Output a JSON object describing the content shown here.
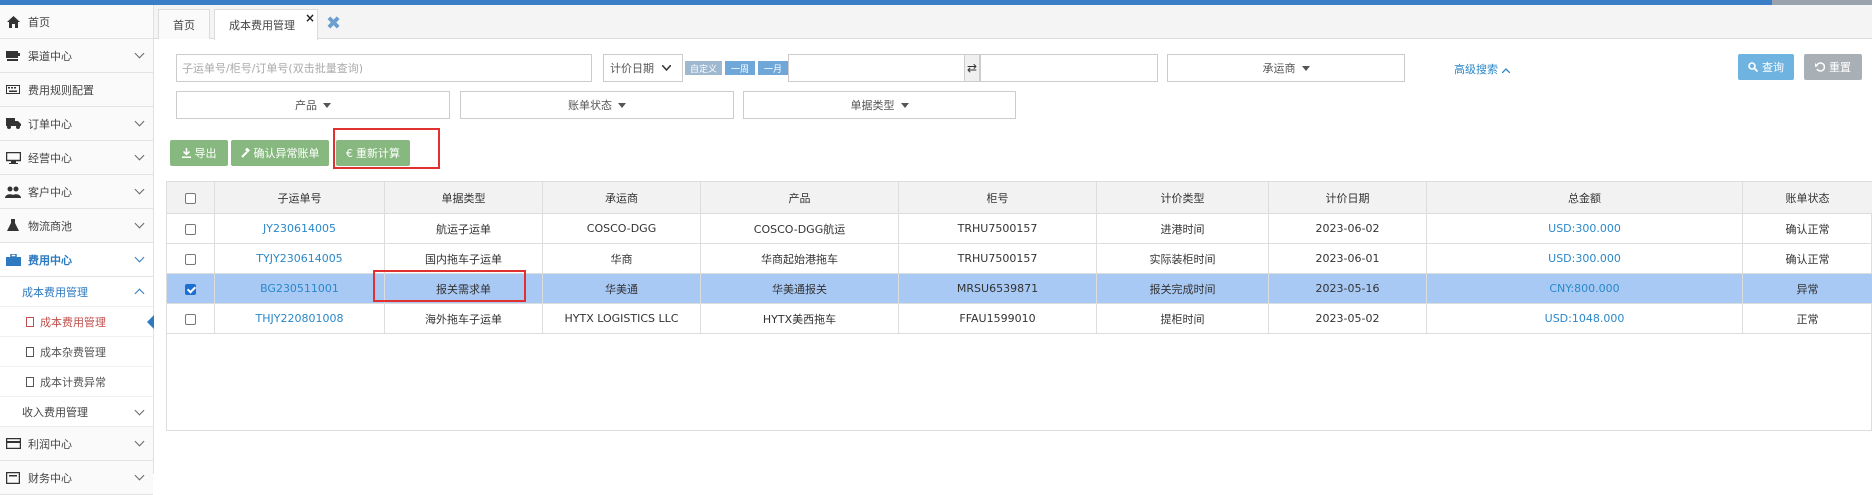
{
  "colors": {
    "accent": "#2d7ac0",
    "selected_row": "#a9c9f5",
    "green_button": "#87b87f",
    "highlight_box": "#e03030"
  },
  "sidebar": {
    "items": [
      {
        "label": "首页",
        "icon": "home-icon",
        "has_chevron": false
      },
      {
        "label": "渠道中心",
        "icon": "channel-icon",
        "has_chevron": true
      },
      {
        "label": "费用规则配置",
        "icon": "keyboard-icon",
        "has_chevron": false
      },
      {
        "label": "订单中心",
        "icon": "truck-icon",
        "has_chevron": true
      },
      {
        "label": "经营中心",
        "icon": "monitor-icon",
        "has_chevron": true
      },
      {
        "label": "客户中心",
        "icon": "users-icon",
        "has_chevron": true
      },
      {
        "label": "物流商池",
        "icon": "flask-icon",
        "has_chevron": true
      },
      {
        "label": "费用中心",
        "icon": "briefcase-icon",
        "has_chevron": true
      }
    ],
    "cost_group": {
      "label": "成本费用管理"
    },
    "cost_leaves": [
      {
        "label": "成本费用管理"
      },
      {
        "label": "成本杂费管理"
      },
      {
        "label": "成本计费异常"
      }
    ],
    "income_group": {
      "label": "收入费用管理"
    },
    "bottom_items": [
      {
        "label": "利润中心",
        "icon": "credit-card-icon"
      },
      {
        "label": "财务中心",
        "icon": "finance-icon"
      }
    ]
  },
  "tabs": [
    {
      "label": "首页"
    },
    {
      "label": "成本费用管理",
      "close": "×"
    }
  ],
  "filters": {
    "search_placeholder": "子运单号/柜号/订单号(双击批量查询)",
    "date_type": "计价日期",
    "quick": [
      "自定义",
      "一周",
      "一月"
    ],
    "swap": "⇄",
    "carrier": "承运商",
    "advanced": "高级搜索",
    "query": "查询",
    "reset": "重置",
    "product": "产品",
    "bill_status": "账单状态",
    "doc_type": "单据类型"
  },
  "actions": {
    "export": "导出",
    "confirm_abnormal": "确认异常账单",
    "recalc": "重新计算"
  },
  "table": {
    "headers": [
      "子运单号",
      "单据类型",
      "承运商",
      "产品",
      "柜号",
      "计价类型",
      "计价日期",
      "总金额",
      "账单状态"
    ],
    "rows": [
      {
        "checked": false,
        "cells": [
          "JY230614005",
          "航运子运单",
          "COSCO-DGG",
          "COSCO-DGG航运",
          "TRHU7500157",
          "进港时间",
          "2023-06-02",
          "USD:300.000",
          "确认正常"
        ]
      },
      {
        "checked": false,
        "cells": [
          "TYJY230614005",
          "国内拖车子运单",
          "华商",
          "华商起始港拖车",
          "TRHU7500157",
          "实际装柜时间",
          "2023-06-01",
          "USD:300.000",
          "确认正常"
        ]
      },
      {
        "checked": true,
        "cells": [
          "BG230511001",
          "报关需求单",
          "华美通",
          "华美通报关",
          "MRSU6539871",
          "报关完成时间",
          "2023-05-16",
          "CNY:800.000",
          "异常"
        ]
      },
      {
        "checked": false,
        "cells": [
          "THJY220801008",
          "海外拖车子运单",
          "HYTX LOGISTICS LLC",
          "HYTX美西拖车",
          "FFAU1599010",
          "提柜时间",
          "2023-05-02",
          "USD:1048.000",
          "正常"
        ]
      }
    ]
  }
}
